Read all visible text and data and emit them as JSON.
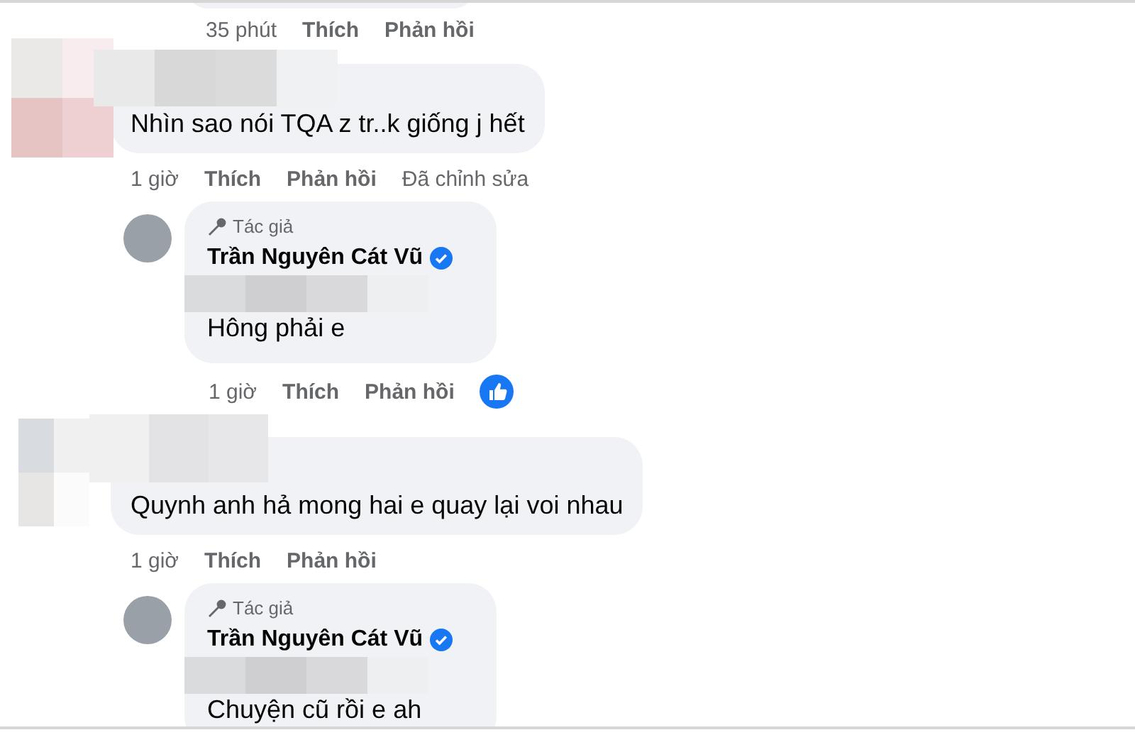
{
  "previous_comment": {
    "time": "35 phút",
    "like": "Thích",
    "reply": "Phản hồi"
  },
  "comments": [
    {
      "text": "Nhìn sao nói TQA z tr..k giống j hết",
      "time": "1 giờ",
      "like": "Thích",
      "reply": "Phản hồi",
      "edited": "Đã chỉnh sửa",
      "replies": [
        {
          "badge": "Tác giả",
          "author": "Trần Nguyên Cát Vũ",
          "verified": true,
          "text": "Hông phải e",
          "time": "1 giờ",
          "like": "Thích",
          "reply": "Phản hồi",
          "liked": true
        }
      ]
    },
    {
      "text": "Quynh anh hả mong hai e quay lại voi nhau",
      "time": "1 giờ",
      "like": "Thích",
      "reply": "Phản hồi",
      "replies": [
        {
          "badge": "Tác giả",
          "author": "Trần Nguyên Cát Vũ",
          "verified": true,
          "text": "Chuyện cũ rồi e ah"
        }
      ]
    }
  ]
}
